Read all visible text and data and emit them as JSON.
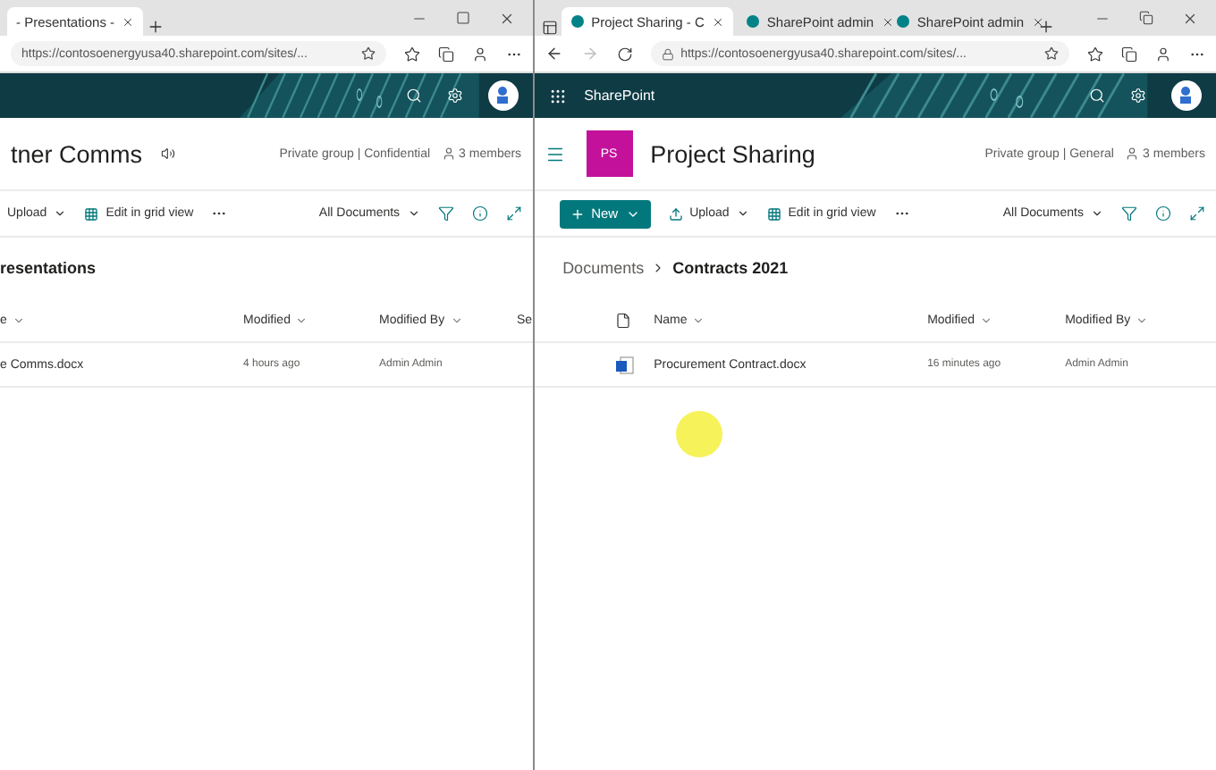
{
  "windows": [
    {
      "tabs": [
        {
          "label": "- Presentations -",
          "selected": true,
          "close": true
        }
      ],
      "url": "https://contosoenergyusa40.sharepoint.com/sites/...",
      "site": {
        "title": "tner Comms",
        "privacy": "Private group | Confidential",
        "members": "3 members",
        "speaker": true
      },
      "commands": [
        {
          "kind": "plain",
          "label": "Upload"
        },
        {
          "kind": "grid",
          "label": "Edit in grid view"
        },
        {
          "kind": "more"
        }
      ],
      "view": "All Documents",
      "library": {
        "heading": "resentations",
        "columns": [
          {
            "label": "e",
            "sortable": true
          },
          {
            "label": "Modified",
            "sortable": true
          },
          {
            "label": "Modified By",
            "sortable": true
          },
          {
            "label": "Se",
            "sortable": false
          }
        ],
        "rows": [
          {
            "name": "e Comms.docx",
            "modified": "4 hours ago",
            "modified_by": "Admin Admin"
          }
        ]
      }
    },
    {
      "tab_actions": true,
      "tabs": [
        {
          "label": "Project Sharing - C",
          "selected": true,
          "close": true
        },
        {
          "label": "SharePoint admin",
          "selected": false,
          "close": true
        },
        {
          "label": "SharePoint admin",
          "selected": false,
          "close": true
        }
      ],
      "nav": true,
      "url": "https://contosoenergyusa40.sharepoint.com/sites/...",
      "suite_label": "SharePoint",
      "site": {
        "title": "Project Sharing",
        "privacy": "Private group | General",
        "members": "3 members",
        "menu": true,
        "tile": {
          "initials": "PS",
          "color": "#c4119c"
        }
      },
      "commands": [
        {
          "kind": "new",
          "label": "New"
        },
        {
          "kind": "upload",
          "label": "Upload"
        },
        {
          "kind": "grid",
          "label": "Edit in grid view"
        },
        {
          "kind": "more"
        }
      ],
      "view": "All Documents",
      "library": {
        "breadcrumb": [
          {
            "label": "Documents",
            "current": false
          },
          {
            "label": "Contracts 2021",
            "current": true
          }
        ],
        "file_type_column": true,
        "columns": [
          {
            "label": "Name",
            "sortable": true
          },
          {
            "label": "Modified",
            "sortable": true
          },
          {
            "label": "Modified By",
            "sortable": true
          }
        ],
        "rows": [
          {
            "name": "Procurement Contract.docx",
            "modified": "16 minutes ago",
            "modified_by": "Admin Admin",
            "word_icon": true
          }
        ]
      },
      "cursor_highlight": true
    }
  ]
}
